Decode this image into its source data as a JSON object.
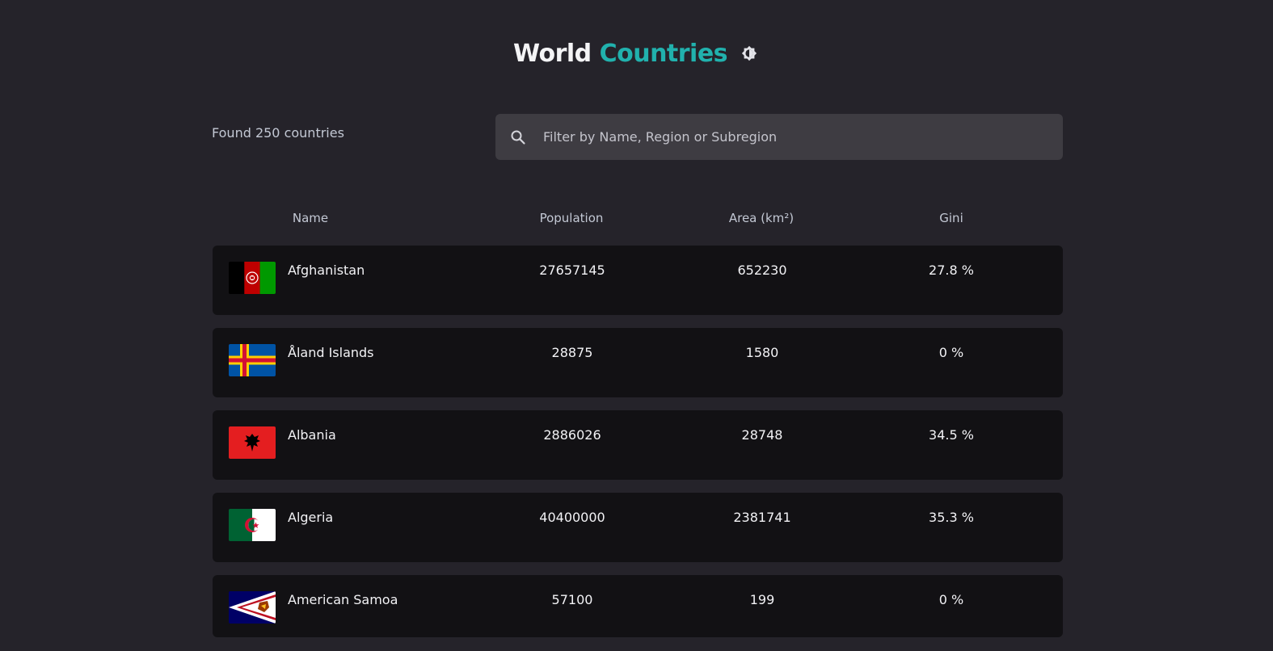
{
  "header": {
    "title_part1": "World",
    "title_part2": "Countries",
    "accent_color": "#21b1ad",
    "theme_toggle_icon": "brightness-icon"
  },
  "found_text": "Found 250 countries",
  "search": {
    "placeholder": "Filter by Name, Region or Subregion",
    "value": "",
    "icon": "search-icon"
  },
  "columns": {
    "name": "Name",
    "population": "Population",
    "area": "Area (km²)",
    "gini": "Gini"
  },
  "countries": [
    {
      "name": "Afghanistan",
      "population": "27657145",
      "area": "652230",
      "gini": "27.8 %",
      "flag": "afghanistan-flag-icon"
    },
    {
      "name": "Åland Islands",
      "population": "28875",
      "area": "1580",
      "gini": "0 %",
      "flag": "aland-flag-icon"
    },
    {
      "name": "Albania",
      "population": "2886026",
      "area": "28748",
      "gini": "34.5 %",
      "flag": "albania-flag-icon"
    },
    {
      "name": "Algeria",
      "population": "40400000",
      "area": "2381741",
      "gini": "35.3 %",
      "flag": "algeria-flag-icon"
    },
    {
      "name": "American Samoa",
      "population": "57100",
      "area": "199",
      "gini": "0 %",
      "flag": "american-samoa-flag-icon"
    }
  ]
}
